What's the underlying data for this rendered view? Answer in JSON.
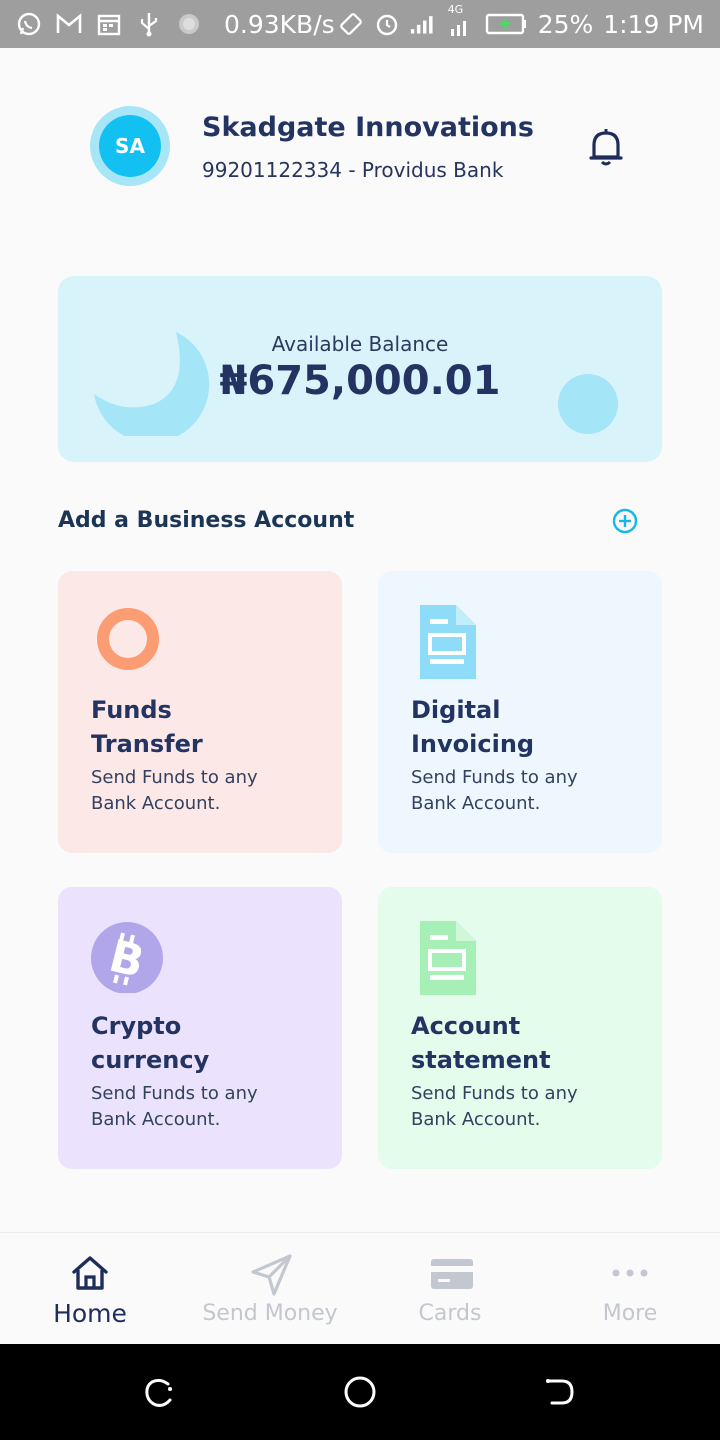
{
  "status_bar": {
    "speed": "0.93KB/s",
    "battery": "25%",
    "time": "1:19 PM",
    "network": "4G"
  },
  "header": {
    "avatar_initials": "SA",
    "business_name": "Skadgate Innovations",
    "account_line": "99201122334 - Providus Bank"
  },
  "balance": {
    "label": "Available Balance",
    "amount": "₦675,000.01"
  },
  "add_account": {
    "label": "Add a Business Account"
  },
  "tiles": [
    {
      "title_line1": "Funds",
      "title_line2": "Transfer",
      "desc_line1": "Send Funds to any",
      "desc_line2": "Bank Account.",
      "icon": "ring-icon",
      "color": "#fb9c73"
    },
    {
      "title_line1": "Digital",
      "title_line2": "Invoicing",
      "desc_line1": "Send Funds to any",
      "desc_line2": "Bank Account.",
      "icon": "invoice-document-icon",
      "color": "#8edcf8"
    },
    {
      "title_line1": "Crypto",
      "title_line2": "currency",
      "desc_line1": "Send Funds to any",
      "desc_line2": "Bank Account.",
      "icon": "bitcoin-icon",
      "color": "#b2a6ea"
    },
    {
      "title_line1": "Account",
      "title_line2": "statement",
      "desc_line1": "Send Funds to any",
      "desc_line2": "Bank Account.",
      "icon": "statement-document-icon",
      "color": "#a6efb7"
    }
  ],
  "bottom_nav": [
    {
      "label": "Home",
      "icon": "home-icon",
      "active": true
    },
    {
      "label": "Send Money",
      "icon": "send-icon",
      "active": false
    },
    {
      "label": "Cards",
      "icon": "card-icon",
      "active": false
    },
    {
      "label": "More",
      "icon": "more-dots-icon",
      "active": false
    }
  ],
  "colors": {
    "primary_text": "#233463",
    "accent": "#12c1f2",
    "balance_card": "#d9f3fb"
  }
}
